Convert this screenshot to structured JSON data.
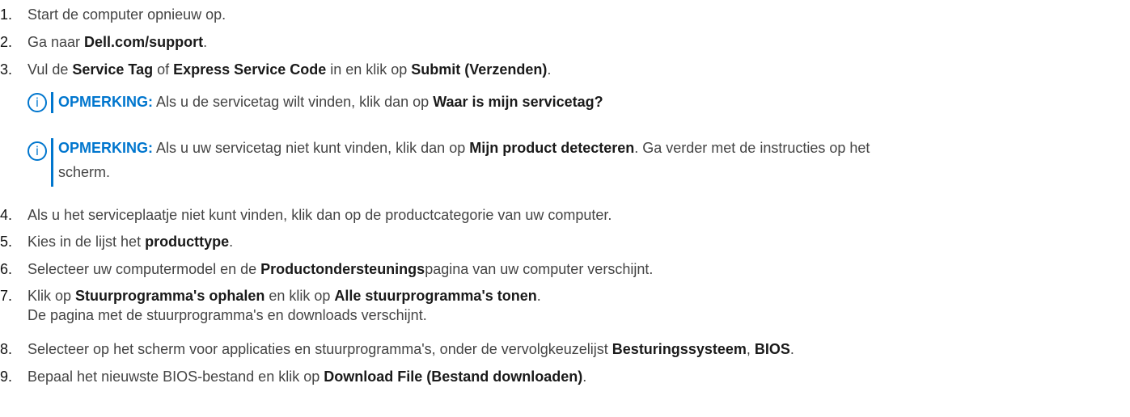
{
  "steps": [
    {
      "num": "1.",
      "parts": [
        "Start de computer opnieuw op."
      ]
    },
    {
      "num": "2.",
      "parts": [
        "Ga naar ",
        "Dell.com/support",
        "."
      ]
    },
    {
      "num": "3.",
      "parts": [
        "Vul de ",
        "Service Tag",
        " of ",
        "Express Service Code",
        " in en klik op ",
        "Submit (Verzenden)",
        "."
      ]
    },
    {
      "num": "4.",
      "parts": [
        "Als u het serviceplaatje niet kunt vinden, klik dan op de productcategorie van uw computer."
      ]
    },
    {
      "num": "5.",
      "parts": [
        "Kies in de lijst het ",
        "producttype",
        "."
      ]
    },
    {
      "num": "6.",
      "parts": [
        "Selecteer uw computermodel en de ",
        "Productondersteunings",
        "pagina van uw computer verschijnt."
      ]
    },
    {
      "num": "7.",
      "parts": [
        "Klik op ",
        "Stuurprogramma's ophalen",
        " en klik op ",
        "Alle stuurprogramma's tonen",
        "."
      ],
      "subtext": "De pagina met de stuurprogramma's en downloads verschijnt."
    },
    {
      "num": "8.",
      "parts": [
        "Selecteer op het scherm voor applicaties en stuurprogramma's, onder de vervolgkeuzelijst ",
        "Besturingssysteem",
        ", ",
        "BIOS",
        "."
      ]
    },
    {
      "num": "9.",
      "parts": [
        "Bepaal het nieuwste BIOS-bestand en klik op ",
        "Download File (Bestand downloaden)",
        "."
      ]
    }
  ],
  "notes": [
    {
      "label": "OPMERKING:",
      "parts": [
        " Als u de servicetag wilt vinden, klik dan op ",
        "Waar is mijn servicetag?"
      ]
    },
    {
      "label": "OPMERKING:",
      "parts": [
        " Als u uw servicetag niet kunt vinden, klik dan op ",
        "Mijn product detecteren",
        ". Ga verder met de instructies op het",
        "scherm."
      ]
    }
  ],
  "icons": {
    "note": "info-icon",
    "note_glyph": "i"
  },
  "colors": {
    "accent": "#0076ce",
    "text": "#444444",
    "bold": "#1a1a1a"
  }
}
